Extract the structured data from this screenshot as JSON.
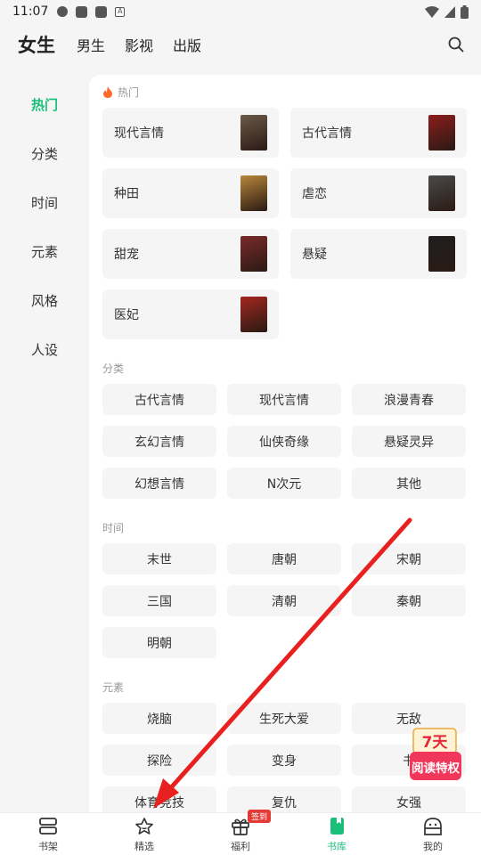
{
  "status": {
    "time": "11:07"
  },
  "top_tabs": [
    "女生",
    "男生",
    "影视",
    "出版"
  ],
  "side_nav": [
    "热门",
    "分类",
    "时间",
    "元素",
    "风格",
    "人设"
  ],
  "hot": {
    "title": "热门",
    "items": [
      {
        "label": "现代言情",
        "color": "#6b5a48"
      },
      {
        "label": "古代言情",
        "color": "#8b1d1d"
      },
      {
        "label": "种田",
        "color": "#b8863a"
      },
      {
        "label": "虐恋",
        "color": "#4a4a4a"
      },
      {
        "label": "甜宠",
        "color": "#7a2a2a"
      },
      {
        "label": "悬疑",
        "color": "#1e1e1e"
      },
      {
        "label": "医妃",
        "color": "#a3271f"
      }
    ]
  },
  "categories": {
    "title": "分类",
    "items": [
      "古代言情",
      "现代言情",
      "浪漫青春",
      "玄幻言情",
      "仙侠奇缘",
      "悬疑灵异",
      "幻想言情",
      "N次元",
      "其他"
    ]
  },
  "time": {
    "title": "时间",
    "items": [
      "末世",
      "唐朝",
      "宋朝",
      "三国",
      "清朝",
      "秦朝",
      "明朝"
    ]
  },
  "elements": {
    "title": "元素",
    "items": [
      "烧脑",
      "生死大爱",
      "无敌",
      "探险",
      "变身",
      "书",
      "体育竞技",
      "复仇",
      "女强"
    ]
  },
  "promo": {
    "line1": "7天",
    "line2": "阅读特权"
  },
  "bottom_tabs": [
    {
      "label": "书架",
      "icon": "bookshelf-icon"
    },
    {
      "label": "精选",
      "icon": "star-icon"
    },
    {
      "label": "福利",
      "icon": "gift-icon",
      "badge": "签到"
    },
    {
      "label": "书库",
      "icon": "book-icon"
    },
    {
      "label": "我的",
      "icon": "profile-icon"
    }
  ],
  "colors": {
    "accent": "#1bbf7a",
    "arrow": "#e8201f"
  }
}
